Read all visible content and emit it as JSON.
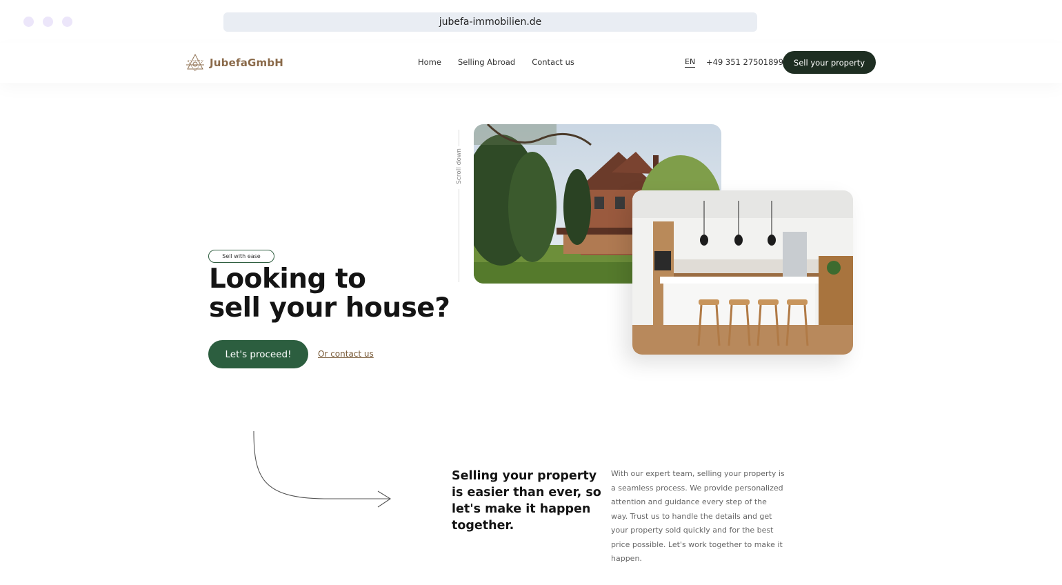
{
  "browser": {
    "url": "jubefa-immobilien.de"
  },
  "header": {
    "logo_text": "JubefaGmbH",
    "nav": [
      "Home",
      "Selling Abroad",
      "Contact us"
    ],
    "language": "EN",
    "phone": "+49 351 27501899",
    "cta_label": "Sell your property"
  },
  "hero": {
    "badge": "Sell with ease",
    "title_line1": "Looking to",
    "title_line2": "sell your house?",
    "primary_button": "Let's proceed!",
    "secondary_link": "Or contact us",
    "scroll_label": "Scroll down"
  },
  "section": {
    "heading": "Selling your property is easier than ever, so let's make it happen together.",
    "body": "With our expert team, selling your property is a seamless process. We provide personalized attention and guidance every step of the way. Trust us to handle the details and get your property sold quickly and for the best price possible. Let's work together to make it happen."
  },
  "colors": {
    "dark_green": "#1e2e22",
    "brand_green": "#2c5e3f",
    "brown": "#8a6a4a",
    "url_bar": "#e9edf3",
    "window_dot": "#ece6fa"
  },
  "icons": [
    "logo-mark-icon",
    "curved-arrow-icon"
  ]
}
